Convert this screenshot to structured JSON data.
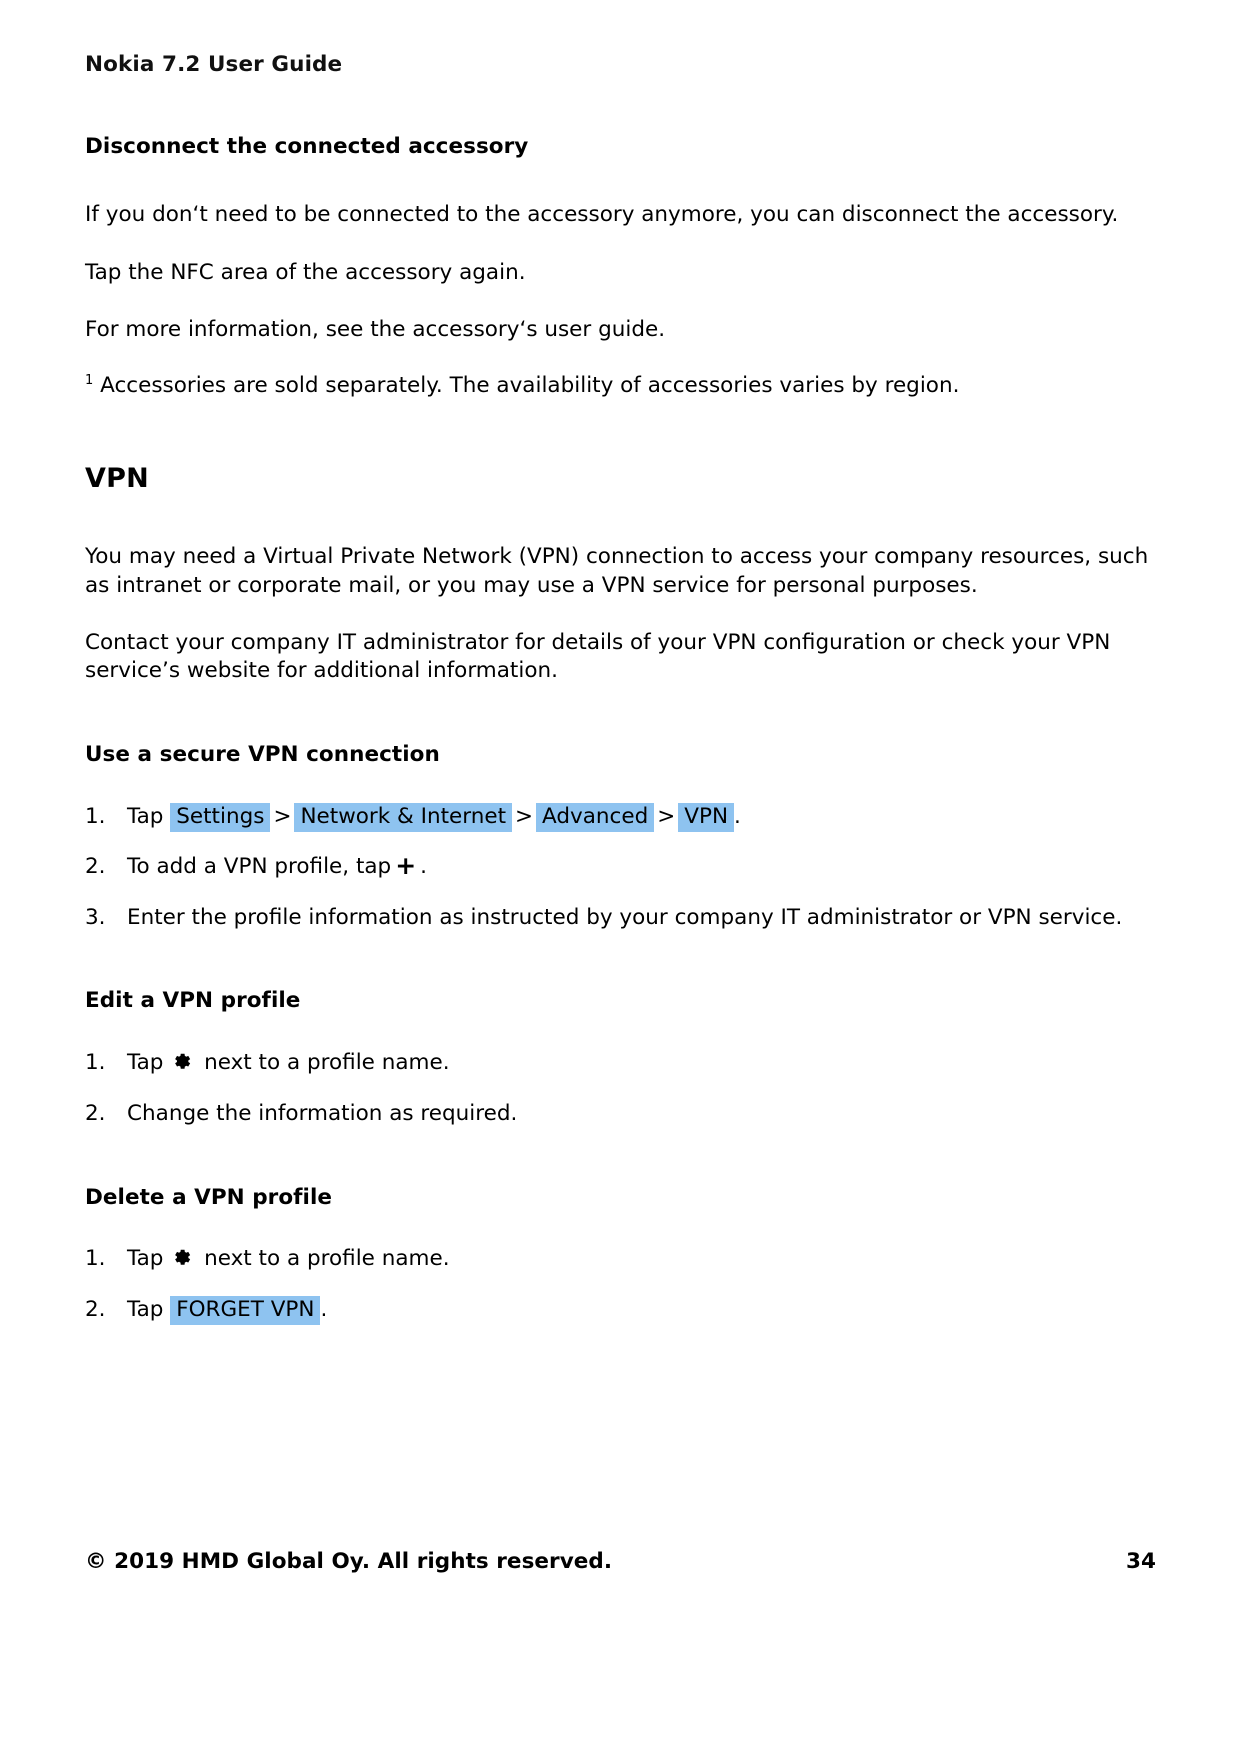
{
  "document": {
    "running_head": "Nokia 7.2 User Guide",
    "footer_copyright": "© 2019 HMD Global Oy. All rights reserved.",
    "page_number": "34"
  },
  "colors": {
    "chip_highlight": "#8ec3f0",
    "text": "#000000",
    "page_background": "#ffffff"
  },
  "sections": {
    "disconnect": {
      "heading": "Disconnect the connected accessory",
      "paragraph_1": "If you don‘t need to be connected to the accessory anymore, you can disconnect the accessory.",
      "paragraph_2": "Tap the NFC area of the accessory again.",
      "paragraph_3": "For more information, see the accessory‘s user guide.",
      "footnote_marker": "1",
      "footnote_text": " Accessories are sold separately. The availability of accessories varies by region."
    },
    "vpn": {
      "heading": "VPN",
      "paragraph_1": "You may need a Virtual Private Network (VPN) connection to access your company resources, such as intranet or corporate mail, or you may use a VPN service for personal purposes.",
      "paragraph_2": "Contact your company IT administrator for details of your VPN configuration or check your VPN service’s website for additional information."
    },
    "use_secure_vpn": {
      "heading": "Use a secure VPN connection",
      "step1": {
        "number": "1.",
        "lead": "Tap",
        "chip_1": "Settings",
        "separator_1": ">",
        "chip_2": "Network & Internet",
        "separator_2": ">",
        "chip_3": "Advanced",
        "separator_3": ">",
        "chip_4": "VPN",
        "trailing": "."
      },
      "step2": {
        "number": "2.",
        "lead": "To add a VPN profile, tap",
        "icon": "plus-icon",
        "icon_glyph": "+",
        "trailing": "."
      },
      "step3": {
        "number": "3.",
        "text": "Enter the profile information as instructed by your company IT administrator or VPN service."
      }
    },
    "edit_vpn_profile": {
      "heading": "Edit a VPN profile",
      "step1": {
        "number": "1.",
        "lead": "Tap",
        "icon": "gear-icon",
        "trailing": "next to a profile name."
      },
      "step2": {
        "number": "2.",
        "text": "Change the information as required."
      }
    },
    "delete_vpn_profile": {
      "heading": "Delete a VPN profile",
      "step1": {
        "number": "1.",
        "lead": "Tap",
        "icon": "gear-icon",
        "trailing": "next to a profile name."
      },
      "step2": {
        "number": "2.",
        "lead": "Tap",
        "chip_1": "FORGET VPN",
        "trailing": "."
      }
    }
  }
}
